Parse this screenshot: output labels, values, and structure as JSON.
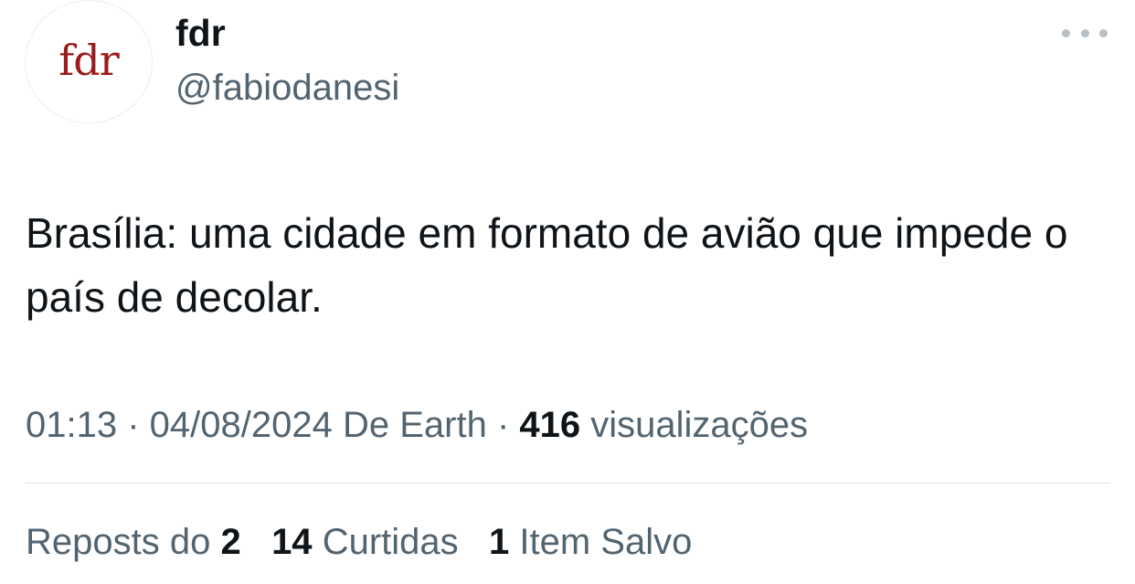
{
  "author": {
    "avatar_text": "fdr",
    "display_name": "fdr",
    "handle": "@fabiodanesi"
  },
  "tweet": {
    "text": "Brasília: uma cidade em formato de avião que impede o país de decolar."
  },
  "meta": {
    "time": "01:13",
    "separator": " · ",
    "date": "04/08/2024",
    "source": "De Earth",
    "views_count": "416",
    "views_label": "visualizações"
  },
  "stats": {
    "reposts_label": "Reposts do",
    "reposts_count": "2",
    "likes_count": "14",
    "likes_label": "Curtidas",
    "saves_count": "1",
    "saves_label": "Item Salvo"
  },
  "icons": {
    "more": "more-horizontal-icon"
  },
  "colors": {
    "text_primary": "#0f1419",
    "text_secondary": "#536471",
    "divider": "#dfe3e6",
    "logo_red": "#9b1c1c"
  }
}
